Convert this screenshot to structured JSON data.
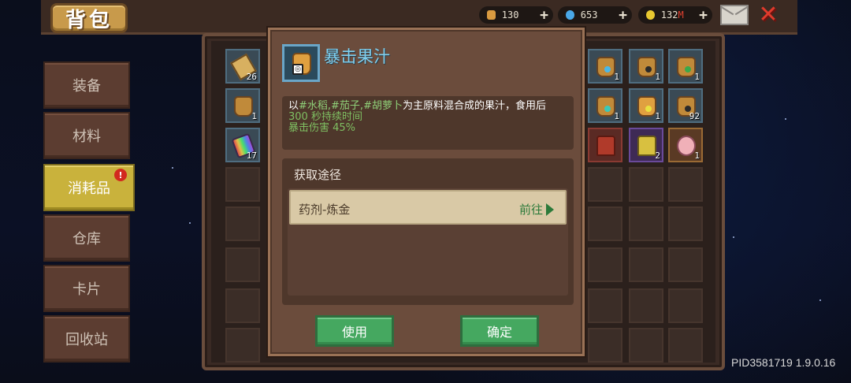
{
  "header": {
    "title": "背包",
    "currencies": [
      {
        "icon": "potion-icon",
        "value": "130",
        "color": "#d89a40"
      },
      {
        "icon": "gem-icon",
        "value": "653",
        "color": "#4aa8e8"
      },
      {
        "icon": "coin-icon",
        "value": "132",
        "suffix": "M",
        "color": "#e8c830"
      }
    ],
    "add_symbol": "+"
  },
  "sidebar": {
    "items": [
      {
        "label": "装备"
      },
      {
        "label": "材料"
      },
      {
        "label": "消耗品",
        "badge": "!"
      },
      {
        "label": "仓库"
      },
      {
        "label": "卡片"
      },
      {
        "label": "回收站"
      }
    ]
  },
  "inventory": {
    "left_counts": [
      "26",
      "1",
      "17"
    ],
    "right_counts": [
      "1",
      "1",
      "1",
      "1",
      "1",
      "92",
      "",
      "2",
      "1"
    ]
  },
  "popup": {
    "title": "暴击果汁",
    "desc_prefix": "以",
    "desc_ingredients": "#水稻,#茄子,#胡萝卜",
    "desc_suffix": "为主原料混合成的果汁，食用后",
    "duration": "300 秒持续时间",
    "effect": "暴击伤害 45%",
    "source_title": "获取途径",
    "source_item": "药剂-炼金",
    "goto_label": "前往",
    "use_button": "使用",
    "confirm_button": "确定"
  },
  "footer": {
    "pid": "PID3581719 1.9.0.16"
  }
}
